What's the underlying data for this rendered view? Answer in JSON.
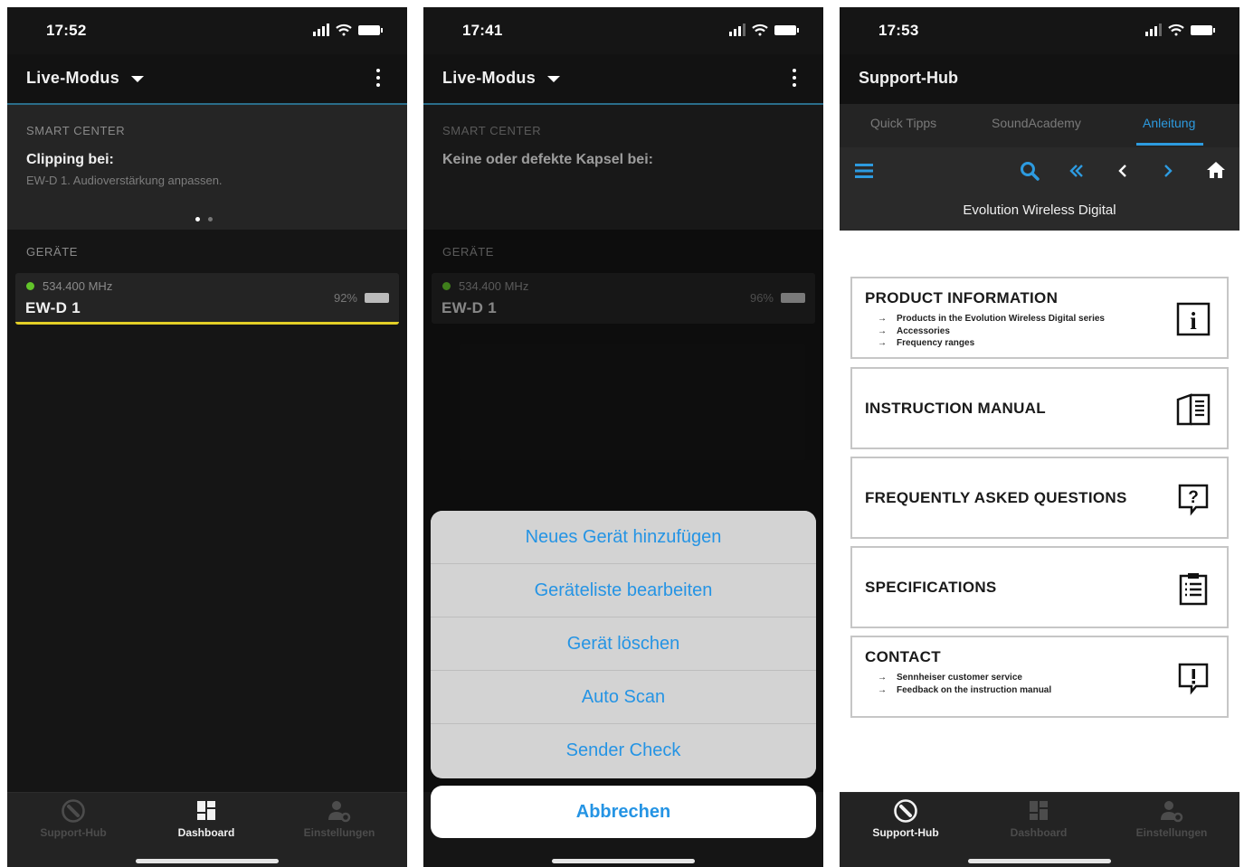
{
  "screen1": {
    "time": "17:52",
    "app_title": "Live-Modus",
    "smart_center_label": "SMART CENTER",
    "smart_headline": "Clipping bei:",
    "smart_sub": "EW-D 1. Audioverstärkung anpassen.",
    "devices_label": "GERÄTE",
    "device": {
      "freq": "534.400 MHz",
      "name": "EW-D 1",
      "battery": "92%"
    }
  },
  "screen2": {
    "time": "17:41",
    "app_title": "Live-Modus",
    "smart_center_label": "SMART CENTER",
    "smart_headline": "Keine oder defekte Kapsel bei:",
    "devices_label": "GERÄTE",
    "device": {
      "freq": "534.400 MHz",
      "name": "EW-D 1",
      "battery": "96%"
    },
    "actions": [
      "Neues Gerät hinzufügen",
      "Geräteliste bearbeiten",
      "Gerät löschen",
      "Auto Scan",
      "Sender Check"
    ],
    "cancel": "Abbrechen"
  },
  "screen3": {
    "time": "17:53",
    "title": "Support-Hub",
    "subtabs": [
      "Quick Tipps",
      "SoundAcademy",
      "Anleitung"
    ],
    "banner": "Evolution Wireless Digital",
    "cards": [
      {
        "title": "PRODUCT INFORMATION",
        "items": [
          "Products in the Evolution Wireless Digital series",
          "Accessories",
          "Frequency ranges"
        ],
        "icon": "info-icon"
      },
      {
        "title": "INSTRUCTION MANUAL",
        "items": [],
        "icon": "book-icon"
      },
      {
        "title": "FREQUENTLY ASKED QUESTIONS",
        "items": [],
        "icon": "question-icon"
      },
      {
        "title": "SPECIFICATIONS",
        "items": [],
        "icon": "clipboard-icon"
      },
      {
        "title": "CONTACT",
        "items": [
          "Sennheiser customer service",
          "Feedback on the instruction manual"
        ],
        "icon": "exclamation-icon"
      }
    ]
  },
  "tabbar": {
    "support": "Support-Hub",
    "dashboard": "Dashboard",
    "settings": "Einstellungen"
  },
  "colors": {
    "accent_blue": "#2594e4",
    "selection_yellow": "#e3cf27",
    "online_green": "#62c42a",
    "background": "#151515"
  }
}
